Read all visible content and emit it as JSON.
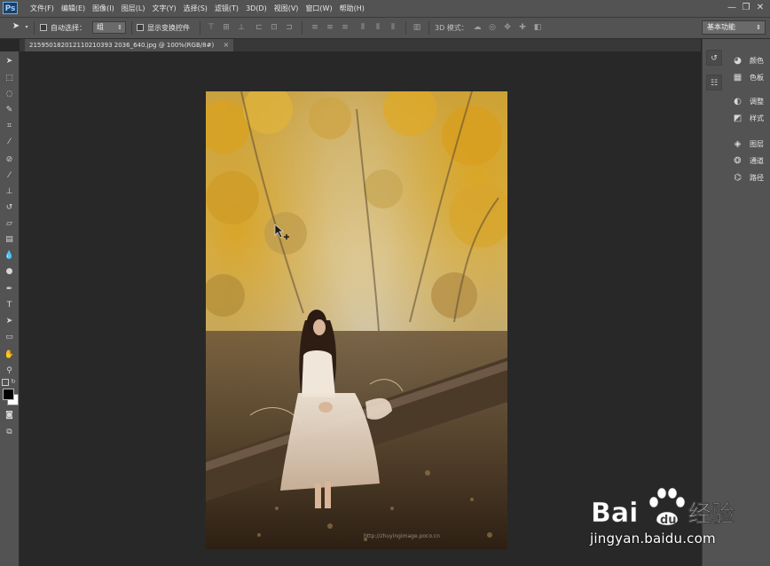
{
  "app": {
    "logo": "Ps"
  },
  "menubar": {
    "items": [
      "文件(F)",
      "编辑(E)",
      "图像(I)",
      "图层(L)",
      "文字(Y)",
      "选择(S)",
      "滤镜(T)",
      "3D(D)",
      "视图(V)",
      "窗口(W)",
      "帮助(H)"
    ],
    "window_controls": {
      "minimize": "—",
      "restore": "❐",
      "close": "✕"
    }
  },
  "options_bar": {
    "auto_select_label": "自动选择：",
    "auto_select_target": "组",
    "show_transform_label": "显示变换控件",
    "mode_3d_label": "3D 模式：",
    "workspace": "基本功能"
  },
  "document": {
    "tab_title": "215950182012110210393 2036_640.jpg @ 100%(RGB/8#)",
    "close": "×"
  },
  "right_panels": [
    {
      "label": "颜色",
      "icon": "palette-icon"
    },
    {
      "label": "色板",
      "icon": "swatches-icon"
    },
    {
      "label": "调整",
      "icon": "adjustments-icon"
    },
    {
      "label": "样式",
      "icon": "styles-icon"
    },
    {
      "label": "图层",
      "icon": "layers-icon"
    },
    {
      "label": "通道",
      "icon": "channels-icon"
    },
    {
      "label": "路径",
      "icon": "paths-icon"
    }
  ],
  "photo": {
    "watermark_text": "http://zhuyingimage.poco.cn"
  },
  "watermark": {
    "brand": "Bai",
    "brand2": "经验",
    "url": "jingyan.baidu.com"
  },
  "colors": {
    "menubar": "#535353",
    "canvas": "#282828",
    "accent": "#6ab0ef"
  }
}
